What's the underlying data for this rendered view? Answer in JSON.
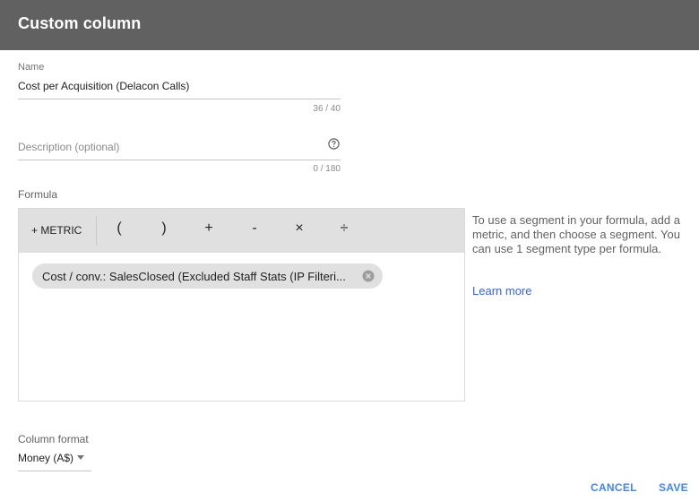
{
  "dialog": {
    "title": "Custom column"
  },
  "name_field": {
    "label": "Name",
    "value": "Cost per Acquisition (Delacon Calls)",
    "counter": "36 / 40"
  },
  "description_field": {
    "placeholder": "Description (optional)",
    "counter": "0 / 180",
    "help_icon": "help-circle-icon"
  },
  "formula": {
    "label": "Formula",
    "metric_button": "+ METRIC",
    "operators": [
      "(",
      ")",
      "+",
      "-",
      "×",
      "÷"
    ],
    "chip_text": "Cost / conv.: SalesClosed (Excluded Staff Stats (IP Filteri...",
    "chip_close_icon": "remove-chip-icon"
  },
  "side_help": {
    "text": "To use a segment in your formula, add a metric, and then choose a segment. You can use 1 segment type per formula.",
    "link": "Learn more"
  },
  "column_format": {
    "label": "Column format",
    "value": "Money (A$)",
    "caret_icon": "dropdown-caret-icon"
  },
  "actions": {
    "cancel": "CANCEL",
    "save": "SAVE"
  },
  "colors": {
    "header": "#616161",
    "accent": "#4285f4",
    "link": "#3367d6",
    "toolbar": "#e0e0e0"
  }
}
